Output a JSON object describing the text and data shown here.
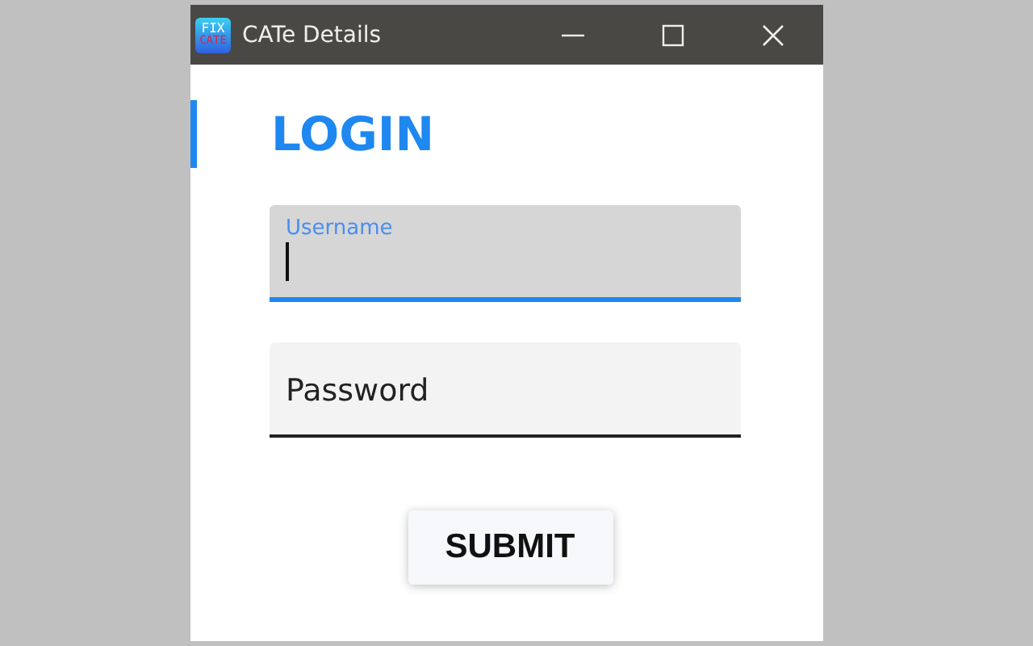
{
  "window": {
    "title": "CATe Details",
    "icon_text": [
      "FIX",
      "CATE"
    ]
  },
  "heading": "LOGIN",
  "fields": [
    {
      "label": "Username",
      "focused": true
    },
    {
      "label": "Password",
      "focused": false
    }
  ],
  "buttons": [
    "SUBMIT"
  ]
}
